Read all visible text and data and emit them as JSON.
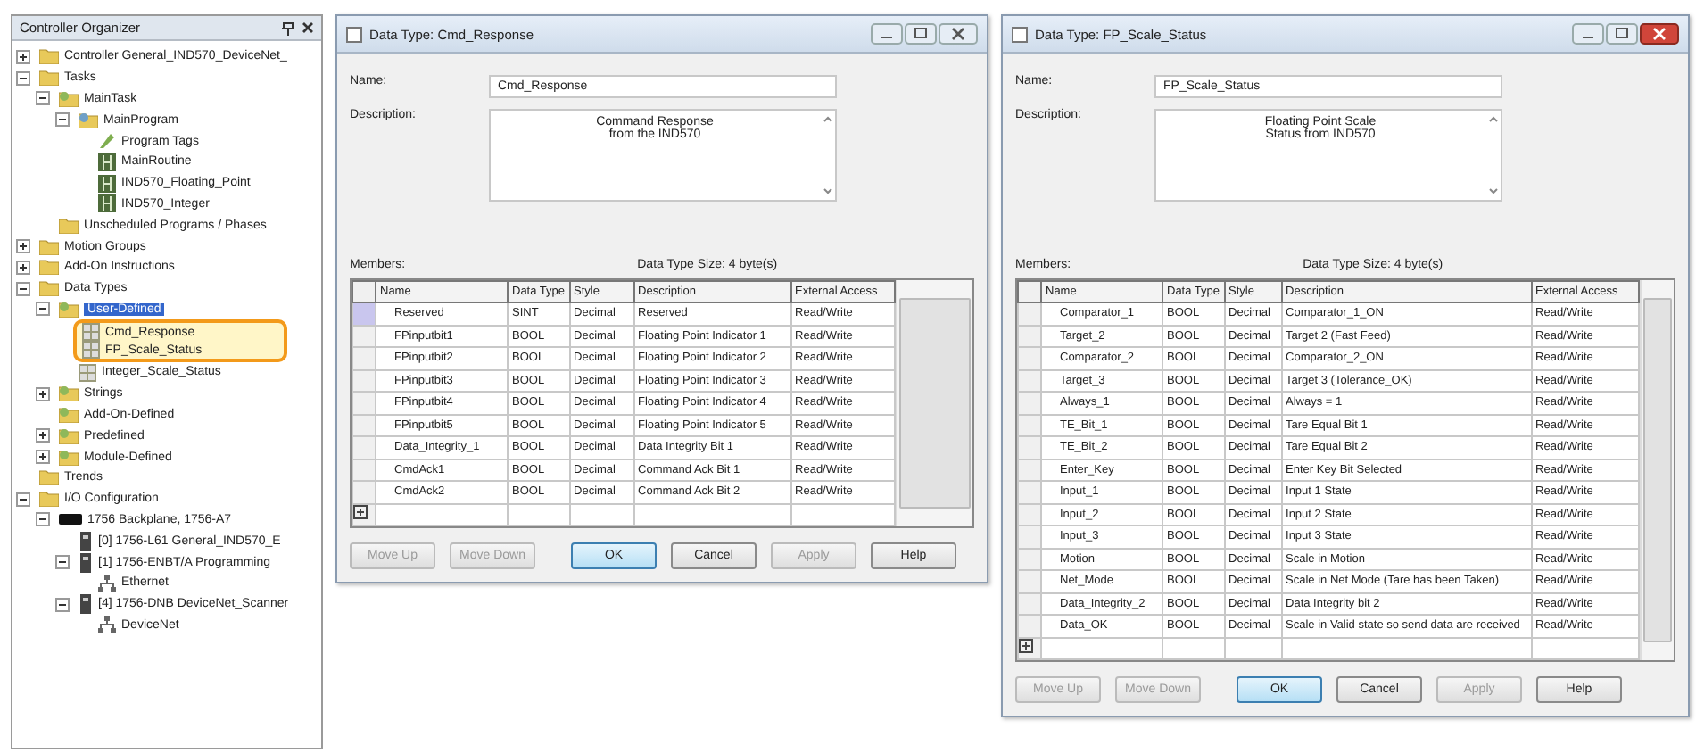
{
  "organizer": {
    "title": "Controller Organizer",
    "items": [
      {
        "label": "Controller General_IND570_DeviceNet_",
        "kind": "folder",
        "expanded": false,
        "selected": false
      },
      {
        "label": "Tasks",
        "kind": "folder",
        "expanded": true,
        "selected": false,
        "children": [
          {
            "label": "MainTask",
            "kind": "task",
            "expanded": true,
            "selected": false,
            "children": [
              {
                "label": "MainProgram",
                "kind": "program",
                "expanded": true,
                "selected": false,
                "children": [
                  {
                    "label": "Program Tags",
                    "kind": "tags",
                    "selected": false
                  },
                  {
                    "label": "MainRoutine",
                    "kind": "routine",
                    "selected": false
                  },
                  {
                    "label": "IND570_Floating_Point",
                    "kind": "routine",
                    "selected": false
                  },
                  {
                    "label": "IND570_Integer",
                    "kind": "routine",
                    "selected": false
                  }
                ]
              }
            ]
          },
          {
            "label": "Unscheduled Programs / Phases",
            "kind": "folder",
            "selected": false
          }
        ]
      },
      {
        "label": "Motion Groups",
        "kind": "folder",
        "expanded": false,
        "selected": false
      },
      {
        "label": "Add-On Instructions",
        "kind": "folder",
        "expanded": false,
        "selected": false
      },
      {
        "label": "Data Types",
        "kind": "folder",
        "expanded": true,
        "selected": false,
        "children": [
          {
            "label": "User-Defined",
            "kind": "task",
            "expanded": true,
            "selected": true,
            "children": [
              {
                "label": "Cmd_Response",
                "kind": "datatype",
                "selected": false,
                "highlighted": true
              },
              {
                "label": "FP_Scale_Status",
                "kind": "datatype",
                "selected": false,
                "highlighted": true
              },
              {
                "label": "Integer_Scale_Status",
                "kind": "datatype",
                "selected": false,
                "highlighted": false
              }
            ]
          },
          {
            "label": "Strings",
            "kind": "task",
            "expanded": false,
            "selected": false
          },
          {
            "label": "Add-On-Defined",
            "kind": "task",
            "selected": false
          },
          {
            "label": "Predefined",
            "kind": "task",
            "expanded": false,
            "selected": false
          },
          {
            "label": "Module-Defined",
            "kind": "task",
            "expanded": false,
            "selected": false
          }
        ]
      },
      {
        "label": "Trends",
        "kind": "folder",
        "selected": false
      },
      {
        "label": "I/O Configuration",
        "kind": "folder",
        "expanded": true,
        "selected": false,
        "children": [
          {
            "label": "1756 Backplane, 1756-A7",
            "kind": "backplane",
            "expanded": true,
            "selected": false,
            "children": [
              {
                "label": "[0] 1756-L61 General_IND570_E",
                "kind": "module",
                "selected": false
              },
              {
                "label": "[1] 1756-ENBT/A Programming",
                "kind": "module",
                "expanded": true,
                "selected": false,
                "children": [
                  {
                    "label": "Ethernet",
                    "kind": "network",
                    "selected": false
                  }
                ]
              },
              {
                "label": "[4] 1756-DNB DeviceNet_Scanner",
                "kind": "module",
                "expanded": true,
                "selected": false,
                "children": [
                  {
                    "label": "DeviceNet",
                    "kind": "network",
                    "selected": false
                  }
                ]
              }
            ]
          }
        ]
      }
    ]
  },
  "dialogs": [
    {
      "title": "Data Type: Cmd_Response",
      "close_active": false,
      "name_label": "Name:",
      "name": "Cmd_Response",
      "description_label": "Description:",
      "description": "Command Response\nfrom the IND570",
      "members_label": "Members:",
      "size": "Data Type Size: 4 byte(s)",
      "columns": [
        "Name",
        "Data Type",
        "Style",
        "Description",
        "External Access"
      ],
      "rows": [
        {
          "selected": true,
          "cells": [
            "Reserved",
            "SINT",
            "Decimal",
            "Reserved",
            "Read/Write"
          ]
        },
        {
          "selected": false,
          "cells": [
            "FPinputbit1",
            "BOOL",
            "Decimal",
            "Floating Point Indicator 1",
            "Read/Write"
          ]
        },
        {
          "selected": false,
          "cells": [
            "FPinputbit2",
            "BOOL",
            "Decimal",
            "Floating Point Indicator 2",
            "Read/Write"
          ]
        },
        {
          "selected": false,
          "cells": [
            "FPinputbit3",
            "BOOL",
            "Decimal",
            "Floating Point Indicator 3",
            "Read/Write"
          ]
        },
        {
          "selected": false,
          "cells": [
            "FPinputbit4",
            "BOOL",
            "Decimal",
            "Floating Point Indicator 4",
            "Read/Write"
          ]
        },
        {
          "selected": false,
          "cells": [
            "FPinputbit5",
            "BOOL",
            "Decimal",
            "Floating Point Indicator 5",
            "Read/Write"
          ]
        },
        {
          "selected": false,
          "cells": [
            "Data_Integrity_1",
            "BOOL",
            "Decimal",
            "Data Integrity Bit 1",
            "Read/Write"
          ]
        },
        {
          "selected": false,
          "cells": [
            "CmdAck1",
            "BOOL",
            "Decimal",
            "Command Ack Bit 1",
            "Read/Write"
          ]
        },
        {
          "selected": false,
          "cells": [
            "CmdAck2",
            "BOOL",
            "Decimal",
            "Command Ack Bit 2",
            "Read/Write"
          ]
        }
      ],
      "buttons": [
        {
          "label": "Move Up",
          "disabled": true,
          "default": false
        },
        {
          "label": "Move Down",
          "disabled": true,
          "default": false
        },
        {
          "label": "OK",
          "disabled": false,
          "default": true
        },
        {
          "label": "Cancel",
          "disabled": false,
          "default": false
        },
        {
          "label": "Apply",
          "disabled": true,
          "default": false
        },
        {
          "label": "Help",
          "disabled": false,
          "default": false
        }
      ]
    },
    {
      "title": "Data Type: FP_Scale_Status",
      "close_active": true,
      "name_label": "Name:",
      "name": "FP_Scale_Status",
      "description_label": "Description:",
      "description": "Floating Point Scale\nStatus from IND570",
      "members_label": "Members:",
      "size": "Data Type Size: 4 byte(s)",
      "columns": [
        "Name",
        "Data Type",
        "Style",
        "Description",
        "External Access"
      ],
      "rows": [
        {
          "selected": false,
          "cells": [
            "Comparator_1",
            "BOOL",
            "Decimal",
            "Comparator_1_ON",
            "Read/Write"
          ]
        },
        {
          "selected": false,
          "cells": [
            "Target_2",
            "BOOL",
            "Decimal",
            "Target 2 (Fast Feed)",
            "Read/Write"
          ]
        },
        {
          "selected": false,
          "cells": [
            "Comparator_2",
            "BOOL",
            "Decimal",
            "Comparator_2_ON",
            "Read/Write"
          ]
        },
        {
          "selected": false,
          "cells": [
            "Target_3",
            "BOOL",
            "Decimal",
            "Target 3 (Tolerance_OK)",
            "Read/Write"
          ]
        },
        {
          "selected": false,
          "cells": [
            "Always_1",
            "BOOL",
            "Decimal",
            "Always = 1",
            "Read/Write"
          ]
        },
        {
          "selected": false,
          "cells": [
            "TE_Bit_1",
            "BOOL",
            "Decimal",
            "Tare Equal Bit 1",
            "Read/Write"
          ]
        },
        {
          "selected": false,
          "cells": [
            "TE_Bit_2",
            "BOOL",
            "Decimal",
            "Tare Equal Bit 2",
            "Read/Write"
          ]
        },
        {
          "selected": false,
          "cells": [
            "Enter_Key",
            "BOOL",
            "Decimal",
            "Enter Key Bit Selected",
            "Read/Write"
          ]
        },
        {
          "selected": false,
          "cells": [
            "Input_1",
            "BOOL",
            "Decimal",
            "Input 1 State",
            "Read/Write"
          ]
        },
        {
          "selected": false,
          "cells": [
            "Input_2",
            "BOOL",
            "Decimal",
            "Input 2 State",
            "Read/Write"
          ]
        },
        {
          "selected": false,
          "cells": [
            "Input_3",
            "BOOL",
            "Decimal",
            "Input 3 State",
            "Read/Write"
          ]
        },
        {
          "selected": false,
          "cells": [
            "Motion",
            "BOOL",
            "Decimal",
            "Scale in Motion",
            "Read/Write"
          ]
        },
        {
          "selected": false,
          "cells": [
            "Net_Mode",
            "BOOL",
            "Decimal",
            "Scale in Net Mode (Tare has been Taken)",
            "Read/Write"
          ]
        },
        {
          "selected": false,
          "cells": [
            "Data_Integrity_2",
            "BOOL",
            "Decimal",
            "Data Integrity bit 2",
            "Read/Write"
          ]
        },
        {
          "selected": false,
          "cells": [
            "Data_OK",
            "BOOL",
            "Decimal",
            "Scale in Valid state so send data are received",
            "Read/Write"
          ]
        }
      ],
      "buttons": [
        {
          "label": "Move Up",
          "disabled": true,
          "default": false
        },
        {
          "label": "Move Down",
          "disabled": true,
          "default": false
        },
        {
          "label": "OK",
          "disabled": false,
          "default": true
        },
        {
          "label": "Cancel",
          "disabled": false,
          "default": false
        },
        {
          "label": "Apply",
          "disabled": true,
          "default": false
        },
        {
          "label": "Help",
          "disabled": false,
          "default": false
        }
      ]
    }
  ]
}
